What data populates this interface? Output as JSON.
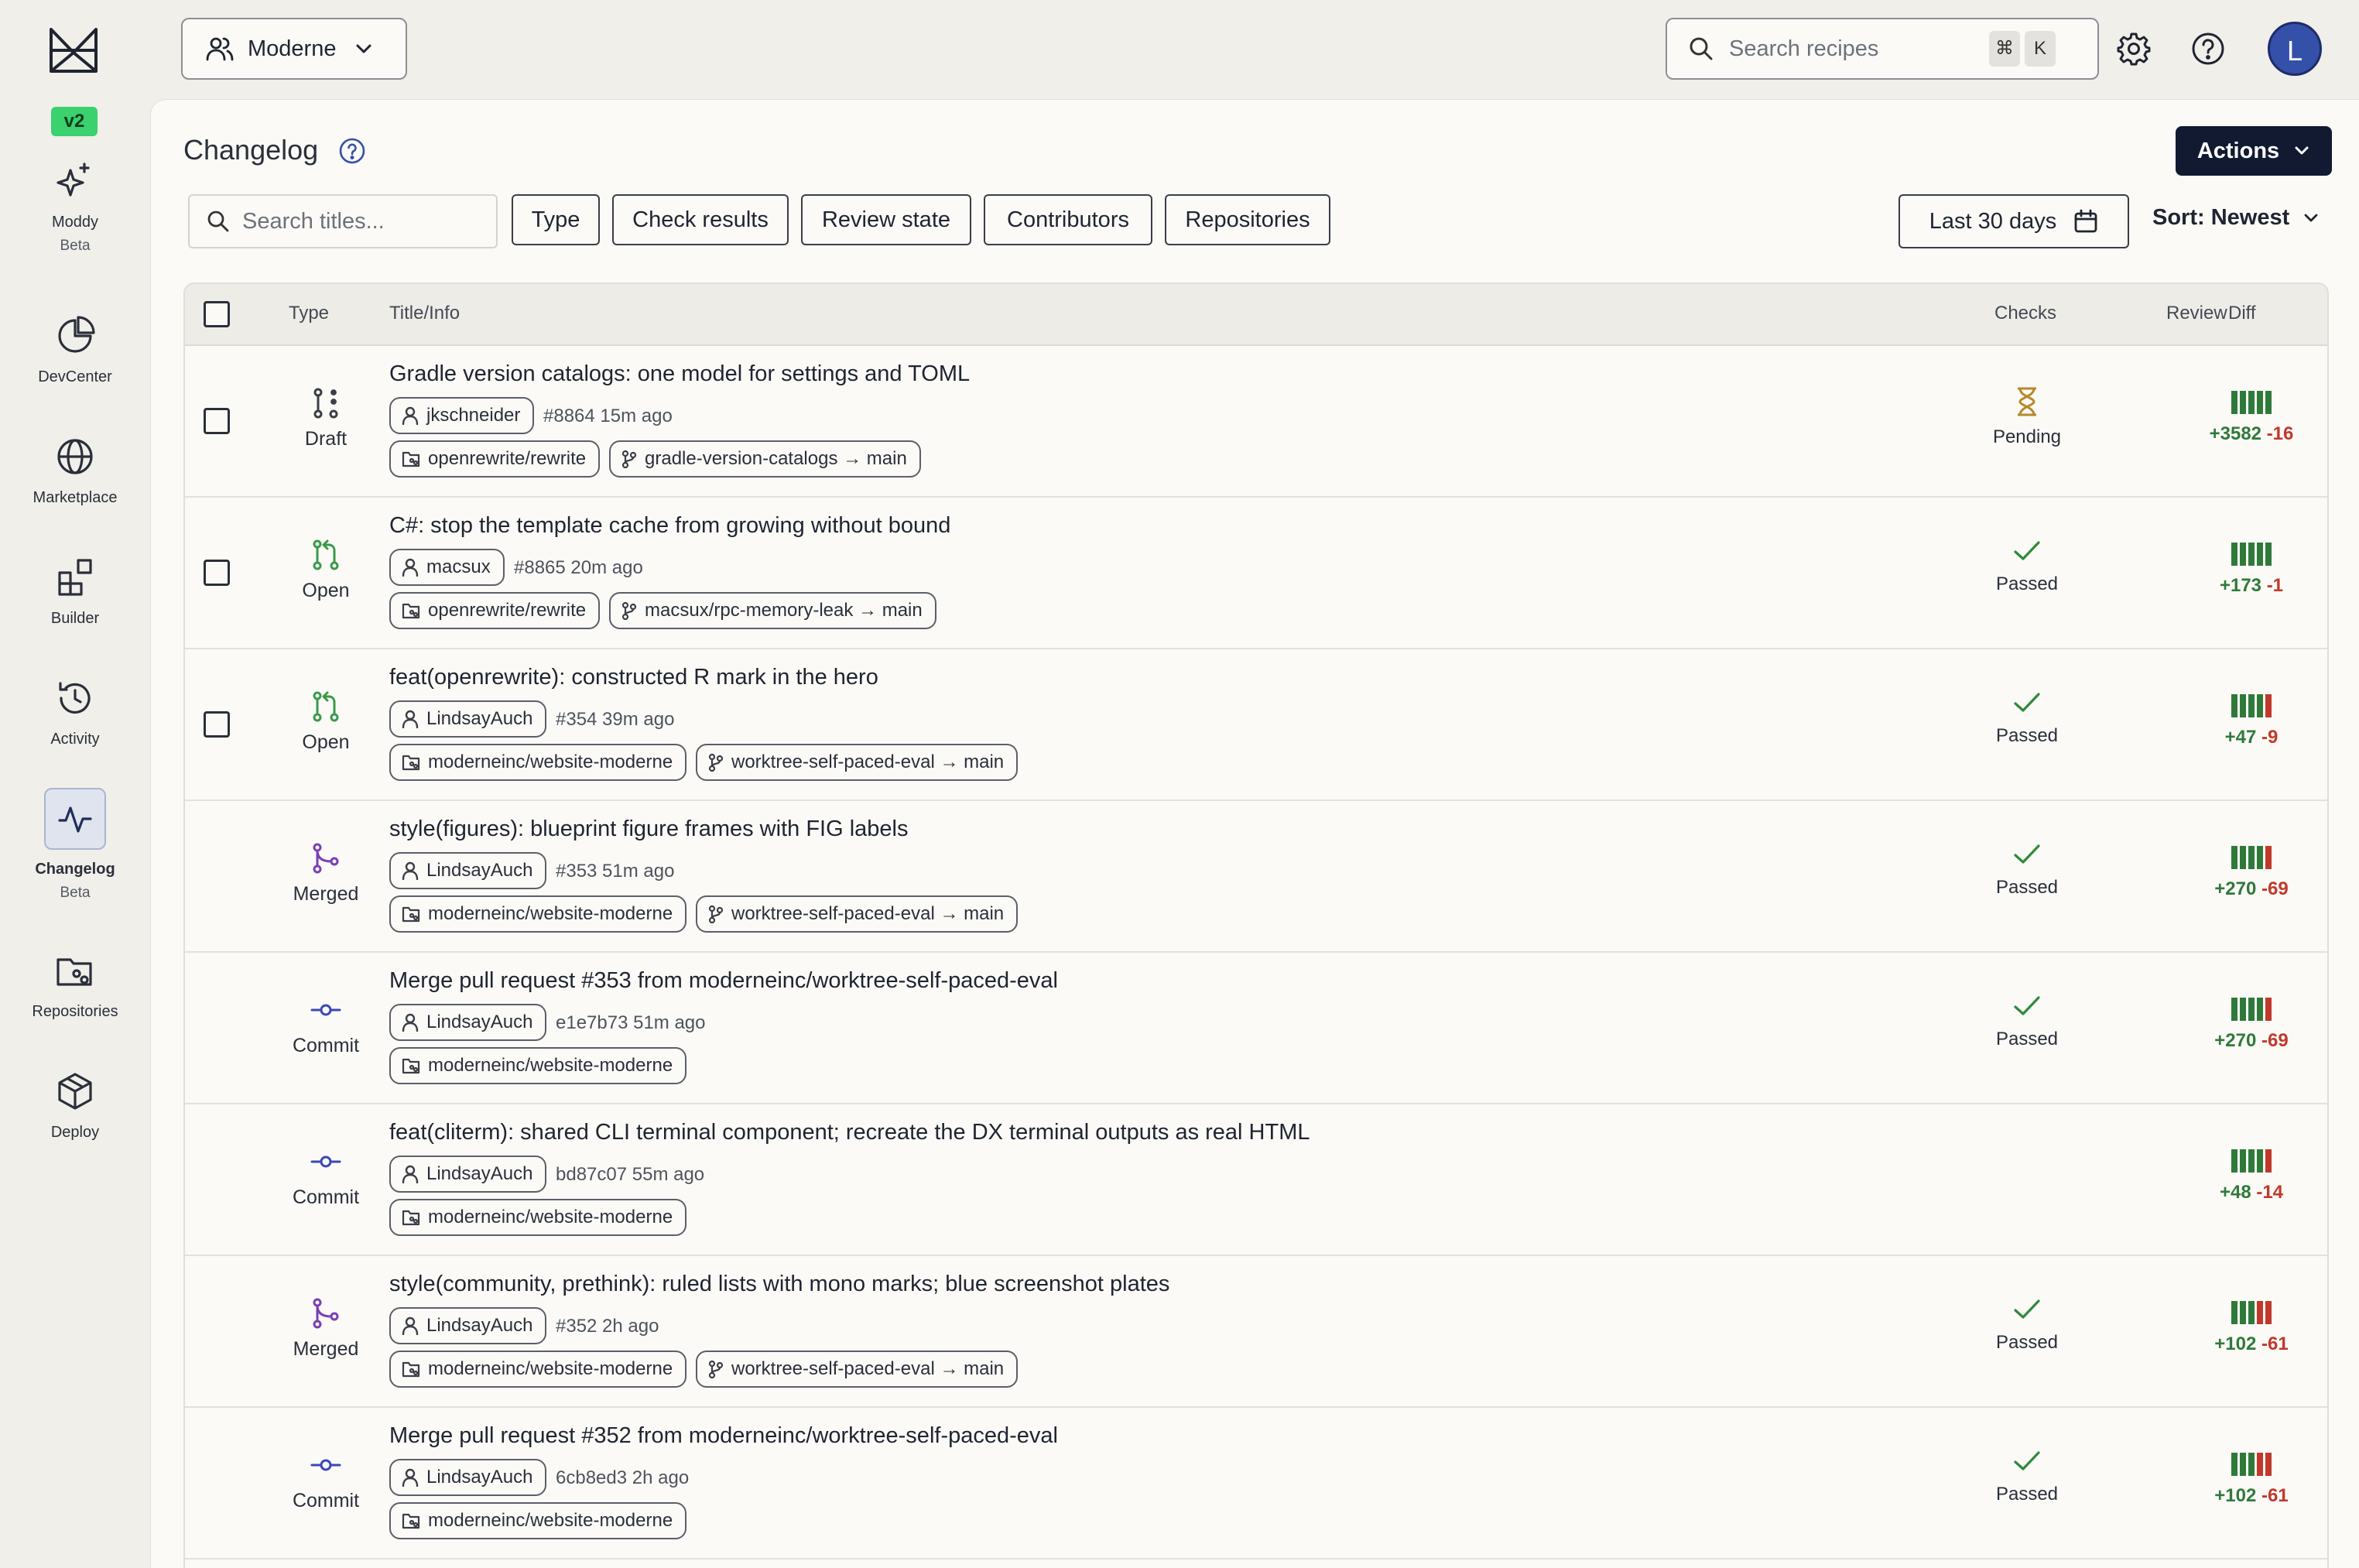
{
  "sidebar": {
    "version": "v2",
    "items": [
      {
        "label": "Moddy",
        "sub": "Beta",
        "icon": "sparkle-icon"
      },
      {
        "label": "DevCenter",
        "sub": "",
        "icon": "pie-chart-icon"
      },
      {
        "label": "Marketplace",
        "sub": "",
        "icon": "globe-icon"
      },
      {
        "label": "Builder",
        "sub": "",
        "icon": "blocks-icon"
      },
      {
        "label": "Activity",
        "sub": "",
        "icon": "history-icon"
      },
      {
        "label": "Changelog",
        "sub": "Beta",
        "icon": "activity-pulse-icon"
      },
      {
        "label": "Repositories",
        "sub": "",
        "icon": "folder-git-icon"
      },
      {
        "label": "Deploy",
        "sub": "",
        "icon": "package-icon"
      }
    ]
  },
  "topbar": {
    "org": "Moderne",
    "search_placeholder": "Search recipes",
    "kbd_cmd": "⌘",
    "kbd_key": "K",
    "avatar": "L"
  },
  "page": {
    "title": "Changelog",
    "actions_label": "Actions",
    "title_search_placeholder": "Search titles...",
    "filters": [
      "Type",
      "Check results",
      "Review state",
      "Contributors",
      "Repositories"
    ],
    "date_range": "Last 30 days",
    "sort": "Sort: Newest"
  },
  "table": {
    "headers": {
      "type": "Type",
      "title": "Title/Info",
      "checks": "Checks",
      "review": "Review",
      "diff": "Diff"
    },
    "rows": [
      {
        "type": "Draft",
        "title": "Gradle version catalogs: one model for settings and TOML",
        "author": "jkschneider",
        "meta": "#8864 15m ago",
        "repo": "openrewrite/rewrite",
        "branch": "gradle-version-catalogs → main",
        "check": "Pending",
        "add": "+3582",
        "del": "-16",
        "bars": "ggggg"
      },
      {
        "type": "Open",
        "title": "C#: stop the template cache from growing without bound",
        "author": "macsux",
        "meta": "#8865 20m ago",
        "repo": "openrewrite/rewrite",
        "branch": "macsux/rpc-memory-leak → main",
        "check": "Passed",
        "add": "+173",
        "del": "-1",
        "bars": "ggggg"
      },
      {
        "type": "Open",
        "title": "feat(openrewrite): constructed R mark in the hero",
        "author": "LindsayAuch",
        "meta": "#354 39m ago",
        "repo": "moderneinc/website-moderne",
        "branch": "worktree-self-paced-eval → main",
        "check": "Passed",
        "add": "+47",
        "del": "-9",
        "bars": "ggggr"
      },
      {
        "type": "Merged",
        "title": "style(figures): blueprint figure frames with FIG labels",
        "author": "LindsayAuch",
        "meta": "#353 51m ago",
        "repo": "moderneinc/website-moderne",
        "branch": "worktree-self-paced-eval → main",
        "check": "Passed",
        "add": "+270",
        "del": "-69",
        "bars": "ggggr"
      },
      {
        "type": "Commit",
        "title": "Merge pull request #353 from moderneinc/worktree-self-paced-eval",
        "author": "LindsayAuch",
        "meta": "e1e7b73 51m ago",
        "repo": "moderneinc/website-moderne",
        "branch": "",
        "check": "Passed",
        "add": "+270",
        "del": "-69",
        "bars": "ggggr"
      },
      {
        "type": "Commit",
        "title": "feat(cliterm): shared CLI terminal component; recreate the DX terminal outputs as real HTML",
        "author": "LindsayAuch",
        "meta": "bd87c07 55m ago",
        "repo": "moderneinc/website-moderne",
        "branch": "",
        "check": "",
        "add": "+48",
        "del": "-14",
        "bars": "ggggr"
      },
      {
        "type": "Merged",
        "title": "style(community, prethink): ruled lists with mono marks; blue screenshot plates",
        "author": "LindsayAuch",
        "meta": "#352 2h ago",
        "repo": "moderneinc/website-moderne",
        "branch": "worktree-self-paced-eval → main",
        "check": "Passed",
        "add": "+102",
        "del": "-61",
        "bars": "gggrr"
      },
      {
        "type": "Commit",
        "title": "Merge pull request #352 from moderneinc/worktree-self-paced-eval",
        "author": "LindsayAuch",
        "meta": "6cb8ed3 2h ago",
        "repo": "moderneinc/website-moderne",
        "branch": "",
        "check": "Passed",
        "add": "+102",
        "del": "-61",
        "bars": "gggrr"
      }
    ]
  },
  "colors": {
    "accent": "#121a32",
    "badge": "#3bd16f",
    "open": "#3a9a4a",
    "merged": "#7a3fb5",
    "commit": "#3a48b8",
    "pending": "#b7892a",
    "add": "#2f7a3a",
    "del": "#c0392b"
  }
}
